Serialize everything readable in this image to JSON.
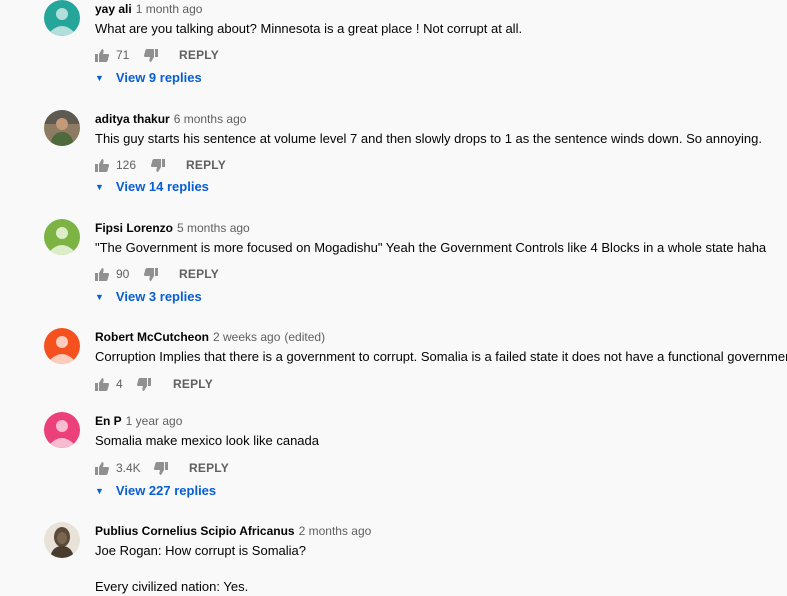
{
  "comments": [
    {
      "author": "yay ali",
      "time": "1 month ago",
      "text": "What are you talking about? Minnesota is a great place ! Not corrupt at all.",
      "likes": "71",
      "reply_label": "REPLY",
      "view_replies": "View 9 replies",
      "avatar_color": "#26a69a"
    },
    {
      "author": "aditya thakur",
      "time": "6 months ago",
      "text": "This guy starts his sentence at volume level 7 and then slowly drops to 1 as the sentence winds down. So annoying.",
      "likes": "126",
      "reply_label": "REPLY",
      "view_replies": "View 14 replies",
      "avatar_color": "#6b5a45"
    },
    {
      "author": "Fipsi Lorenzo",
      "time": "5 months ago",
      "text": "\"The Government is more focused on Mogadishu\" Yeah the Government Controls like 4 Blocks in a whole state haha",
      "likes": "90",
      "reply_label": "REPLY",
      "view_replies": "View 3 replies",
      "avatar_color": "#7cb342"
    },
    {
      "author": "Robert McCutcheon",
      "time": "2 weeks ago",
      "edited": "(edited)",
      "text": "Corruption Implies that there is a government to corrupt. Somalia is a failed state it does not have a functional government",
      "likes": "4",
      "reply_label": "REPLY",
      "avatar_color": "#f4511e"
    },
    {
      "author": "En P",
      "time": "1 year ago",
      "text": "Somalia make mexico look like canada",
      "likes": "3.4K",
      "reply_label": "REPLY",
      "view_replies": "View 227 replies",
      "avatar_color": "#ec407a"
    },
    {
      "author": "Publius Cornelius Scipio Africanus",
      "time": "2 months ago",
      "text_lines": [
        "Joe Rogan: How corrupt is Somalia?",
        "",
        "Every civilized nation: Yes."
      ],
      "avatar_color": "#a1887f"
    }
  ]
}
